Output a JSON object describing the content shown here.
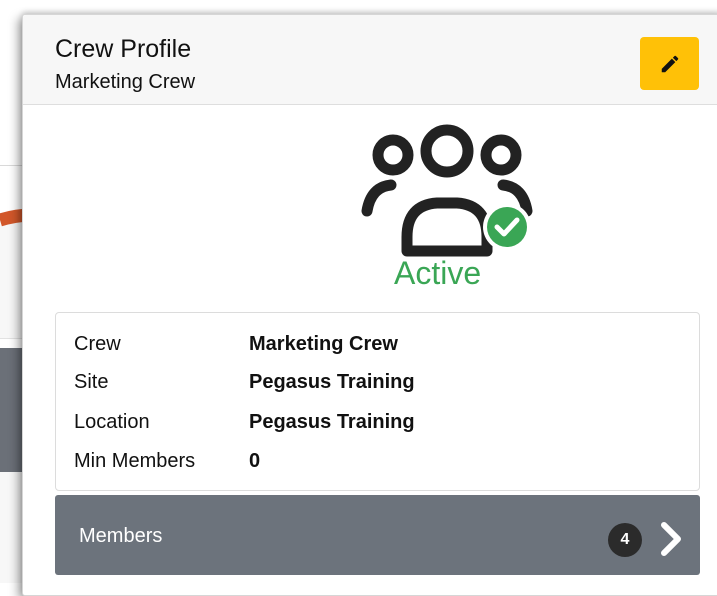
{
  "header": {
    "title": "Crew Profile",
    "subtitle": "Marketing Crew",
    "edit_icon": "pencil-icon"
  },
  "status": {
    "label": "Active",
    "icon": "crew-group-icon",
    "badge_icon": "check-circle-icon",
    "color": "#3aa655"
  },
  "details": [
    {
      "label": "Crew",
      "value": "Marketing Crew"
    },
    {
      "label": "Site",
      "value": "Pegasus Training"
    },
    {
      "label": "Location",
      "value": "Pegasus Training"
    },
    {
      "label": "Min Members",
      "value": "0"
    }
  ],
  "members": {
    "label": "Members",
    "count": "4"
  },
  "colors": {
    "accent_yellow": "#ffc107",
    "bar_gray": "#6c737c",
    "arrow_orange": "#d2572a"
  }
}
